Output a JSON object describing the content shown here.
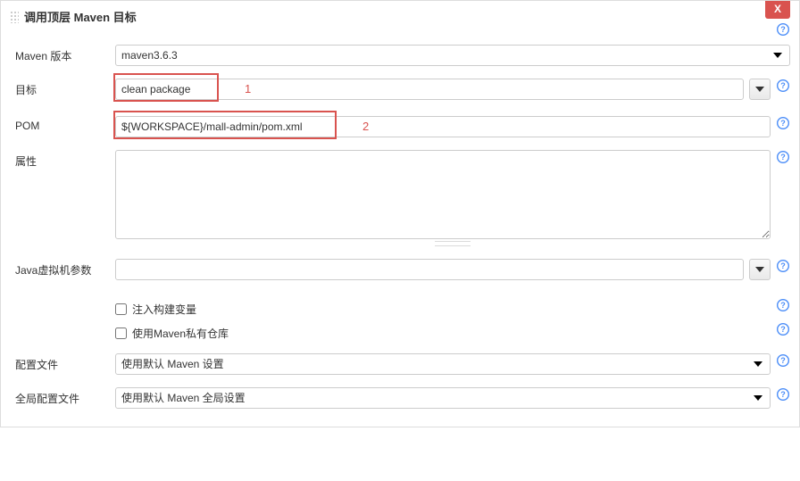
{
  "panel": {
    "title": "调用顶层 Maven 目标",
    "close_label": "X"
  },
  "annotations": {
    "one": "1",
    "two": "2"
  },
  "fields": {
    "mavenVersion": {
      "label": "Maven 版本",
      "value": "maven3.6.3"
    },
    "goals": {
      "label": "目标",
      "value": "clean package"
    },
    "pom": {
      "label": "POM",
      "value": "${WORKSPACE}/mall-admin/pom.xml"
    },
    "properties": {
      "label": "属性",
      "value": ""
    },
    "jvmOptions": {
      "label": "Java虚拟机参数",
      "value": ""
    },
    "injectVars": {
      "label": "注入构建变量"
    },
    "privateRepo": {
      "label": "使用Maven私有仓库"
    },
    "settings": {
      "label": "配置文件",
      "value": "使用默认 Maven 设置"
    },
    "globalSettings": {
      "label": "全局配置文件",
      "value": "使用默认 Maven 全局设置"
    }
  }
}
